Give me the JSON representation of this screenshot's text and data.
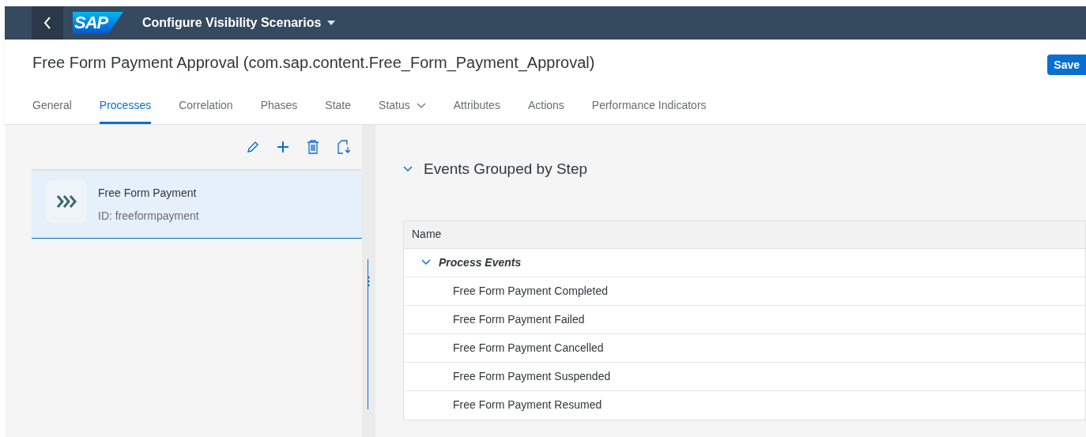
{
  "shell": {
    "logo_text": "SAP",
    "title": "Configure Visibility Scenarios"
  },
  "header": {
    "title": "Free Form Payment Approval (com.sap.content.Free_Form_Payment_Approval)",
    "save": "Save"
  },
  "tabs": [
    {
      "label": "General",
      "selected": false,
      "dropdown": false
    },
    {
      "label": "Processes",
      "selected": true,
      "dropdown": false
    },
    {
      "label": "Correlation",
      "selected": false,
      "dropdown": false
    },
    {
      "label": "Phases",
      "selected": false,
      "dropdown": false
    },
    {
      "label": "State",
      "selected": false,
      "dropdown": false
    },
    {
      "label": "Status",
      "selected": false,
      "dropdown": true
    },
    {
      "label": "Attributes",
      "selected": false,
      "dropdown": false
    },
    {
      "label": "Actions",
      "selected": false,
      "dropdown": false
    },
    {
      "label": "Performance Indicators",
      "selected": false,
      "dropdown": false
    }
  ],
  "process_list": [
    {
      "name": "Free Form Payment",
      "id": "ID: freeformpayment",
      "selected": true
    }
  ],
  "section": {
    "title": "Events Grouped by Step",
    "expanded": true,
    "table": {
      "columns": [
        "Name"
      ],
      "groups": [
        {
          "name": "Process Events",
          "expanded": true,
          "rows": [
            "Free Form Payment Completed",
            "Free Form Payment Failed",
            "Free Form Payment Cancelled",
            "Free Form Payment Suspended",
            "Free Form Payment Resumed"
          ]
        }
      ]
    }
  }
}
